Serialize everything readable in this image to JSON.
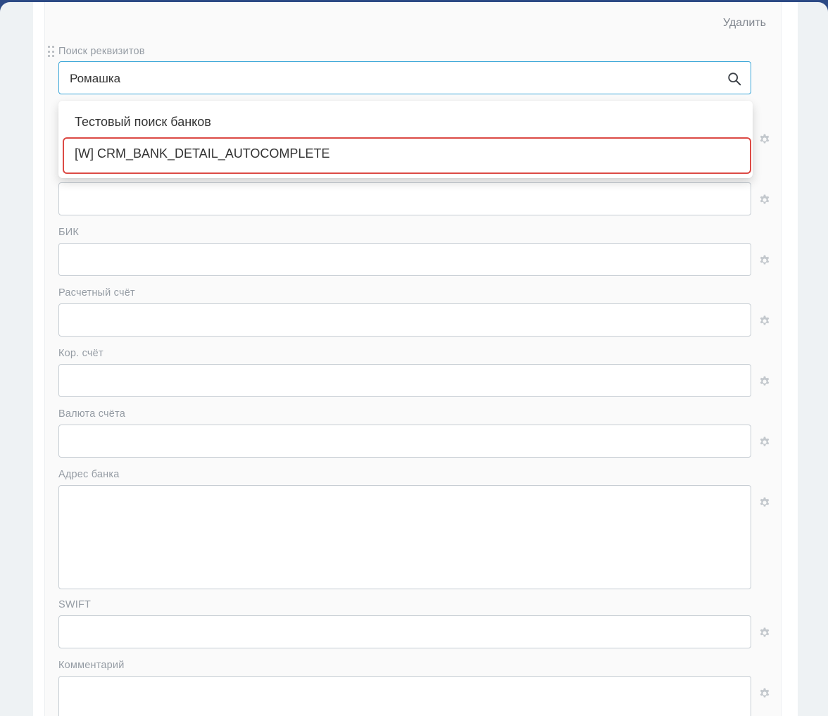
{
  "header": {
    "delete_label": "Удалить"
  },
  "search": {
    "label": "Поиск реквизитов",
    "value": "Ромашка",
    "dropdown": {
      "items": [
        {
          "label": "Тестовый поиск банков"
        },
        {
          "label": "[W] CRM_BANK_DETAIL_AUTOCOMPLETE",
          "highlighted": true
        }
      ]
    }
  },
  "fields": {
    "bik": {
      "label": "БИК"
    },
    "account": {
      "label": "Расчетный счёт"
    },
    "corr_account": {
      "label": "Кор. счёт"
    },
    "currency": {
      "label": "Валюта счёта"
    },
    "bank_address": {
      "label": "Адрес банка"
    },
    "swift": {
      "label": "SWIFT"
    },
    "comment": {
      "label": "Комментарий"
    }
  },
  "icons": {
    "search": "search-icon",
    "settings": "gear-icon",
    "drag": "drag-handle-icon"
  },
  "colors": {
    "focus_border": "#3ba6d8",
    "highlight_border": "#dc4a45",
    "top_bar": "#2c4a85"
  }
}
